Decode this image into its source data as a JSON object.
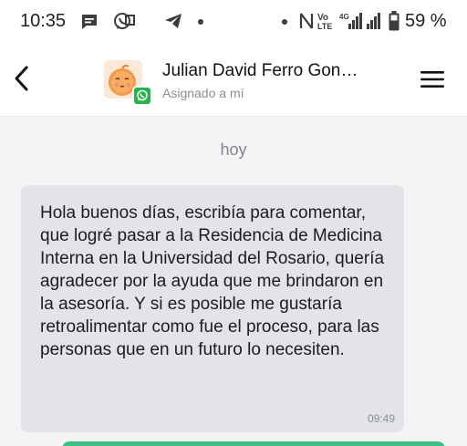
{
  "status_bar": {
    "time": "10:35",
    "battery": "59 %",
    "icons": [
      "message-icon",
      "whatsapp-icon",
      "telegram-icon",
      "dot-icon",
      "nfc-icon",
      "volte-icon",
      "signal-icon",
      "battery-icon"
    ]
  },
  "header": {
    "contact_name": "Julian David Ferro Gon…",
    "assigned": "Asignado a mí",
    "back_icon": "chevron-left-icon",
    "menu_icon": "hamburger-menu-icon",
    "channel_badge": "whatsapp-icon"
  },
  "chat": {
    "date_label": "hoy",
    "messages": [
      {
        "text": "Hola buenos días, escribía para comentar, que logré pasar a la Residencia de Medicina Interna en la Universidad del Rosario, quería agradecer por la ayuda que me brindaron en la asesoría. Y si es posible me gustaría retroalimentar como fue el proceso, para las personas que en un futuro lo necesiten.",
        "time": "09:49",
        "direction": "incoming"
      }
    ]
  },
  "colors": {
    "incoming_bubble": "#e3e4e9",
    "outgoing_bubble": "#3fbf84",
    "whatsapp_green": "#25b34a",
    "background": "#f4f4f5"
  }
}
